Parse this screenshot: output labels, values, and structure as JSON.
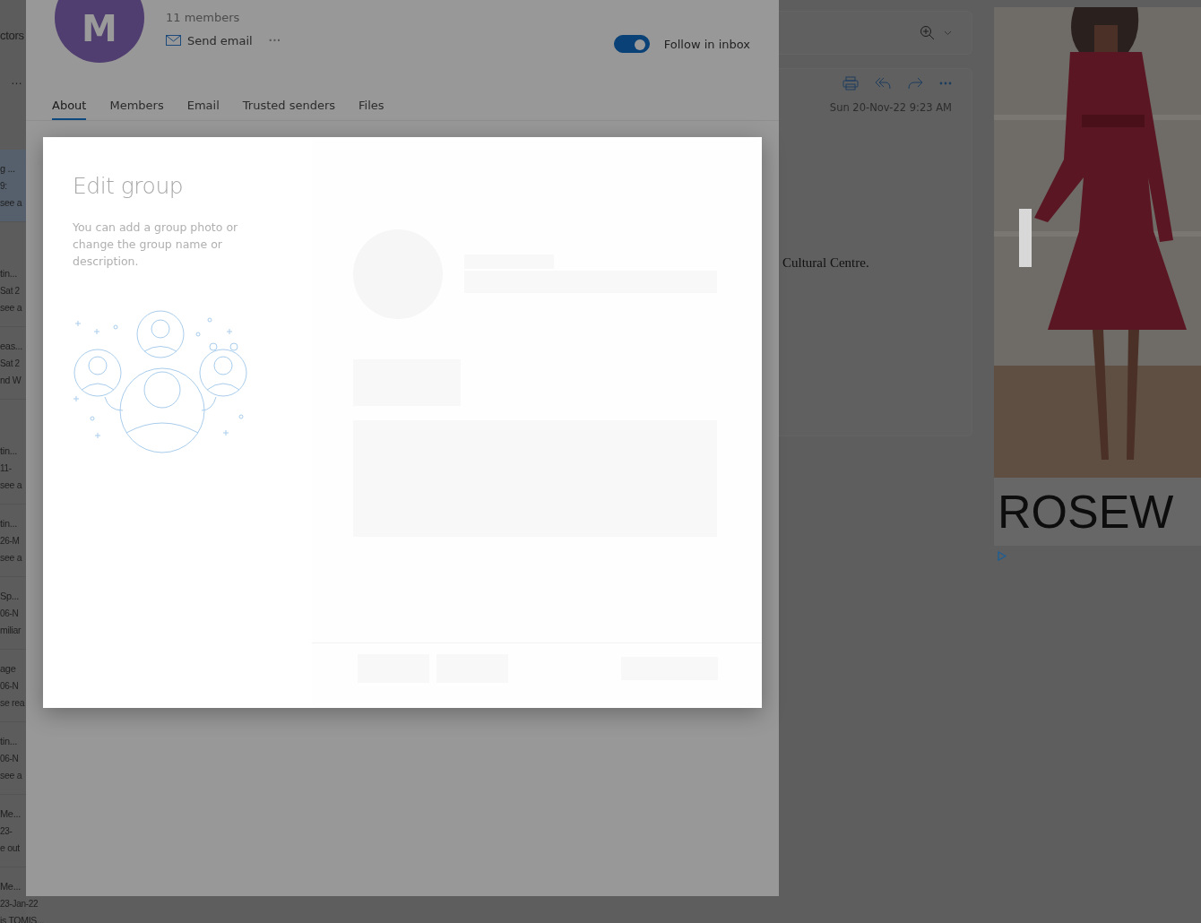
{
  "message_list": {
    "header_fragment": "ctors",
    "more": "…",
    "items": [
      {
        "subject": "g ...",
        "date": "9:",
        "preview": "see a",
        "selected": true
      },
      {
        "subject": "tin...",
        "date": "Sat 2",
        "preview": "see a",
        "selected": false
      },
      {
        "subject": "eas...",
        "date": "Sat 2",
        "preview": "nd W",
        "selected": false
      },
      {
        "subject": "tin...",
        "date": "11-",
        "preview": "see a",
        "selected": false
      },
      {
        "subject": "tin...",
        "date": "26-M",
        "preview": "see a",
        "selected": false
      },
      {
        "subject": "Sp...",
        "date": "06-N",
        "preview": "miliar",
        "selected": false
      },
      {
        "subject": "age",
        "date": "06-N",
        "preview": "se rea",
        "selected": false
      },
      {
        "subject": "tin...",
        "date": "06-N",
        "preview": "see a",
        "selected": false
      },
      {
        "subject": "Me...",
        "date": "23-",
        "preview": "e out",
        "selected": false
      },
      {
        "subject": "Me...",
        "date": "23-Jan-22",
        "preview": "is TOMIS...",
        "selected": false
      }
    ]
  },
  "group": {
    "avatar_letter": "M",
    "members": "11 members",
    "send_email": "Send email",
    "more": "···",
    "follow": {
      "label": "Follow in inbox",
      "on": true
    },
    "tabs": [
      {
        "label": "About",
        "selected": true
      },
      {
        "label": "Members",
        "selected": false
      },
      {
        "label": "Email",
        "selected": false
      },
      {
        "label": "Trusted senders",
        "selected": false
      },
      {
        "label": "Files",
        "selected": false
      }
    ]
  },
  "reading_pane": {
    "date": "Sun 20-Nov-22 9:23 AM",
    "body_fragment": "Cultural Centre."
  },
  "ad": {
    "brand": "ROSEW"
  },
  "dialog": {
    "title": "Edit group",
    "description": "You can add a group photo or change the group name or description."
  }
}
